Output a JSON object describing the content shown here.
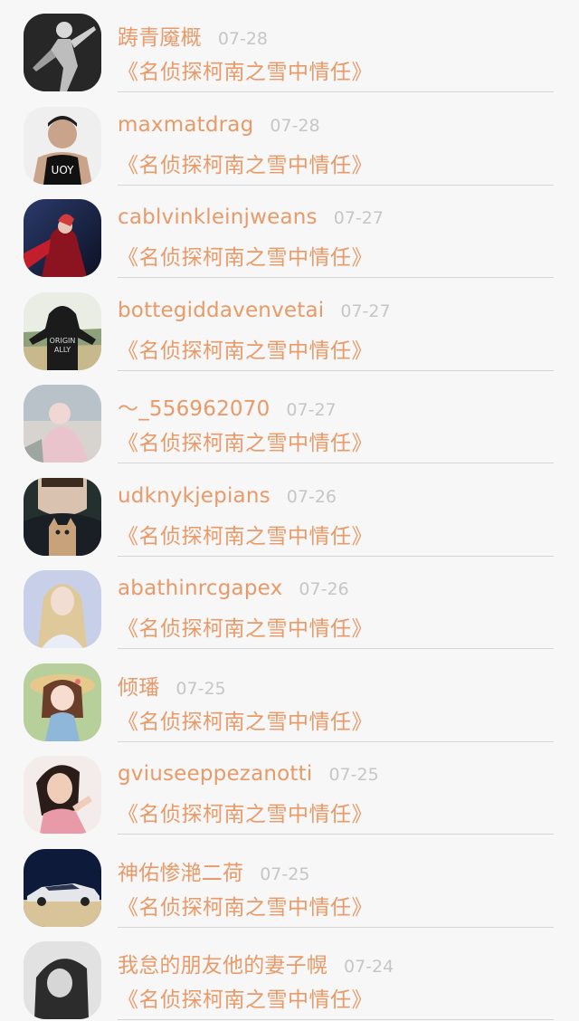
{
  "colors": {
    "accent": "#e89a68",
    "date": "#c6c6c6",
    "divider": "#d6d6d6",
    "background": "#f7f7f7"
  },
  "items": [
    {
      "name": "踌青魇概",
      "date": "07-28",
      "title": "《名侦探柯南之雪中情任》",
      "avatar": "avatar-dancer-bw"
    },
    {
      "name": "maxmatdrag",
      "date": "07-28",
      "title": "《名侦探柯南之雪中情任》",
      "avatar": "avatar-man-tanktop"
    },
    {
      "name": "cablvinkleinjweans",
      "date": "07-27",
      "title": "《名侦探柯南之雪中情任》",
      "avatar": "avatar-fantasy-red"
    },
    {
      "name": "bottegiddavenvetai",
      "date": "07-27",
      "title": "《名侦探柯南之雪中情任》",
      "avatar": "avatar-hoodie-back"
    },
    {
      "name": "〜_556962070",
      "date": "07-27",
      "title": "《名侦探柯南之雪中情任》",
      "avatar": "avatar-pastel-blur"
    },
    {
      "name": "udknykjepians",
      "date": "07-26",
      "title": "《名侦探柯南之雪中情任》",
      "avatar": "avatar-boy-kitten"
    },
    {
      "name": "abathinrcgapex",
      "date": "07-26",
      "title": "《名侦探柯南之雪中情任》",
      "avatar": "avatar-blonde-girl"
    },
    {
      "name": "倾璠",
      "date": "07-25",
      "title": "《名侦探柯南之雪中情任》",
      "avatar": "avatar-anime-girl"
    },
    {
      "name": "gviuseeppezanotti",
      "date": "07-25",
      "title": "《名侦探柯南之雪中情任》",
      "avatar": "avatar-woman-portrait"
    },
    {
      "name": "神佑惨滟二荷",
      "date": "07-25",
      "title": "《名侦探柯南之雪中情任》",
      "avatar": "avatar-sports-car"
    },
    {
      "name": "我怠的朋友他的妻子幌",
      "date": "07-24",
      "title": "《名侦探柯南之雪中情任》",
      "avatar": "avatar-girl-bw"
    }
  ]
}
